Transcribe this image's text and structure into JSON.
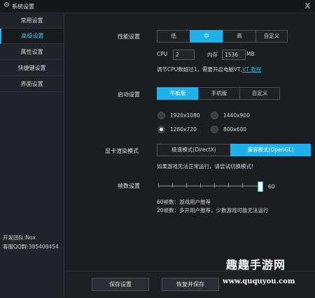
{
  "window": {
    "title": "系统设置",
    "close": "X"
  },
  "sidebar": {
    "items": [
      {
        "label": "常用设置",
        "active": false
      },
      {
        "label": "高级设置",
        "active": true
      },
      {
        "label": "属性设置",
        "active": false
      },
      {
        "label": "快捷键设置",
        "active": false
      },
      {
        "label": "界面设置",
        "active": false
      }
    ],
    "team": "开发团队:Nox",
    "qq": "客服QQ群:385408454"
  },
  "performance": {
    "label": "性能设置",
    "options": [
      "低",
      "中",
      "高",
      "自定义"
    ],
    "selected": "中",
    "cpu_label": "CPU",
    "cpu_value": "2",
    "mem_label": "内存",
    "mem_value": "1536",
    "mem_unit": "MB",
    "hint": "调节CPU数超过1，需要开启电脑VT,",
    "hint_link": "VT 教程"
  },
  "startup": {
    "label": "启动设置",
    "options": [
      "平板版",
      "手机版",
      "自定义"
    ],
    "selected": "平板版",
    "resolutions": [
      {
        "label": "1920x1080",
        "checked": false
      },
      {
        "label": "1440x900",
        "checked": false
      },
      {
        "label": "1280x720",
        "checked": true
      },
      {
        "label": "800x600",
        "checked": false
      }
    ]
  },
  "render": {
    "label": "显卡渲染模式",
    "options": [
      "极速模式(DirectX)",
      "兼容模式(OpenGL)"
    ],
    "selected": "兼容模式(OpenGL)",
    "hint": "如果游戏无法正常运行，请尝试切换模式!"
  },
  "fps": {
    "label": "帧数设置",
    "value": "60",
    "level": 1.0,
    "note1": "60帧数：游戏用户推荐",
    "note2": "20帧数：多开用户推荐，少数游戏可能无法运行"
  },
  "buttons": {
    "save": "保存设置",
    "restore": "恢复并保存"
  },
  "watermark": {
    "main": "趣趣手游网",
    "url": "www.ququyou.com"
  }
}
